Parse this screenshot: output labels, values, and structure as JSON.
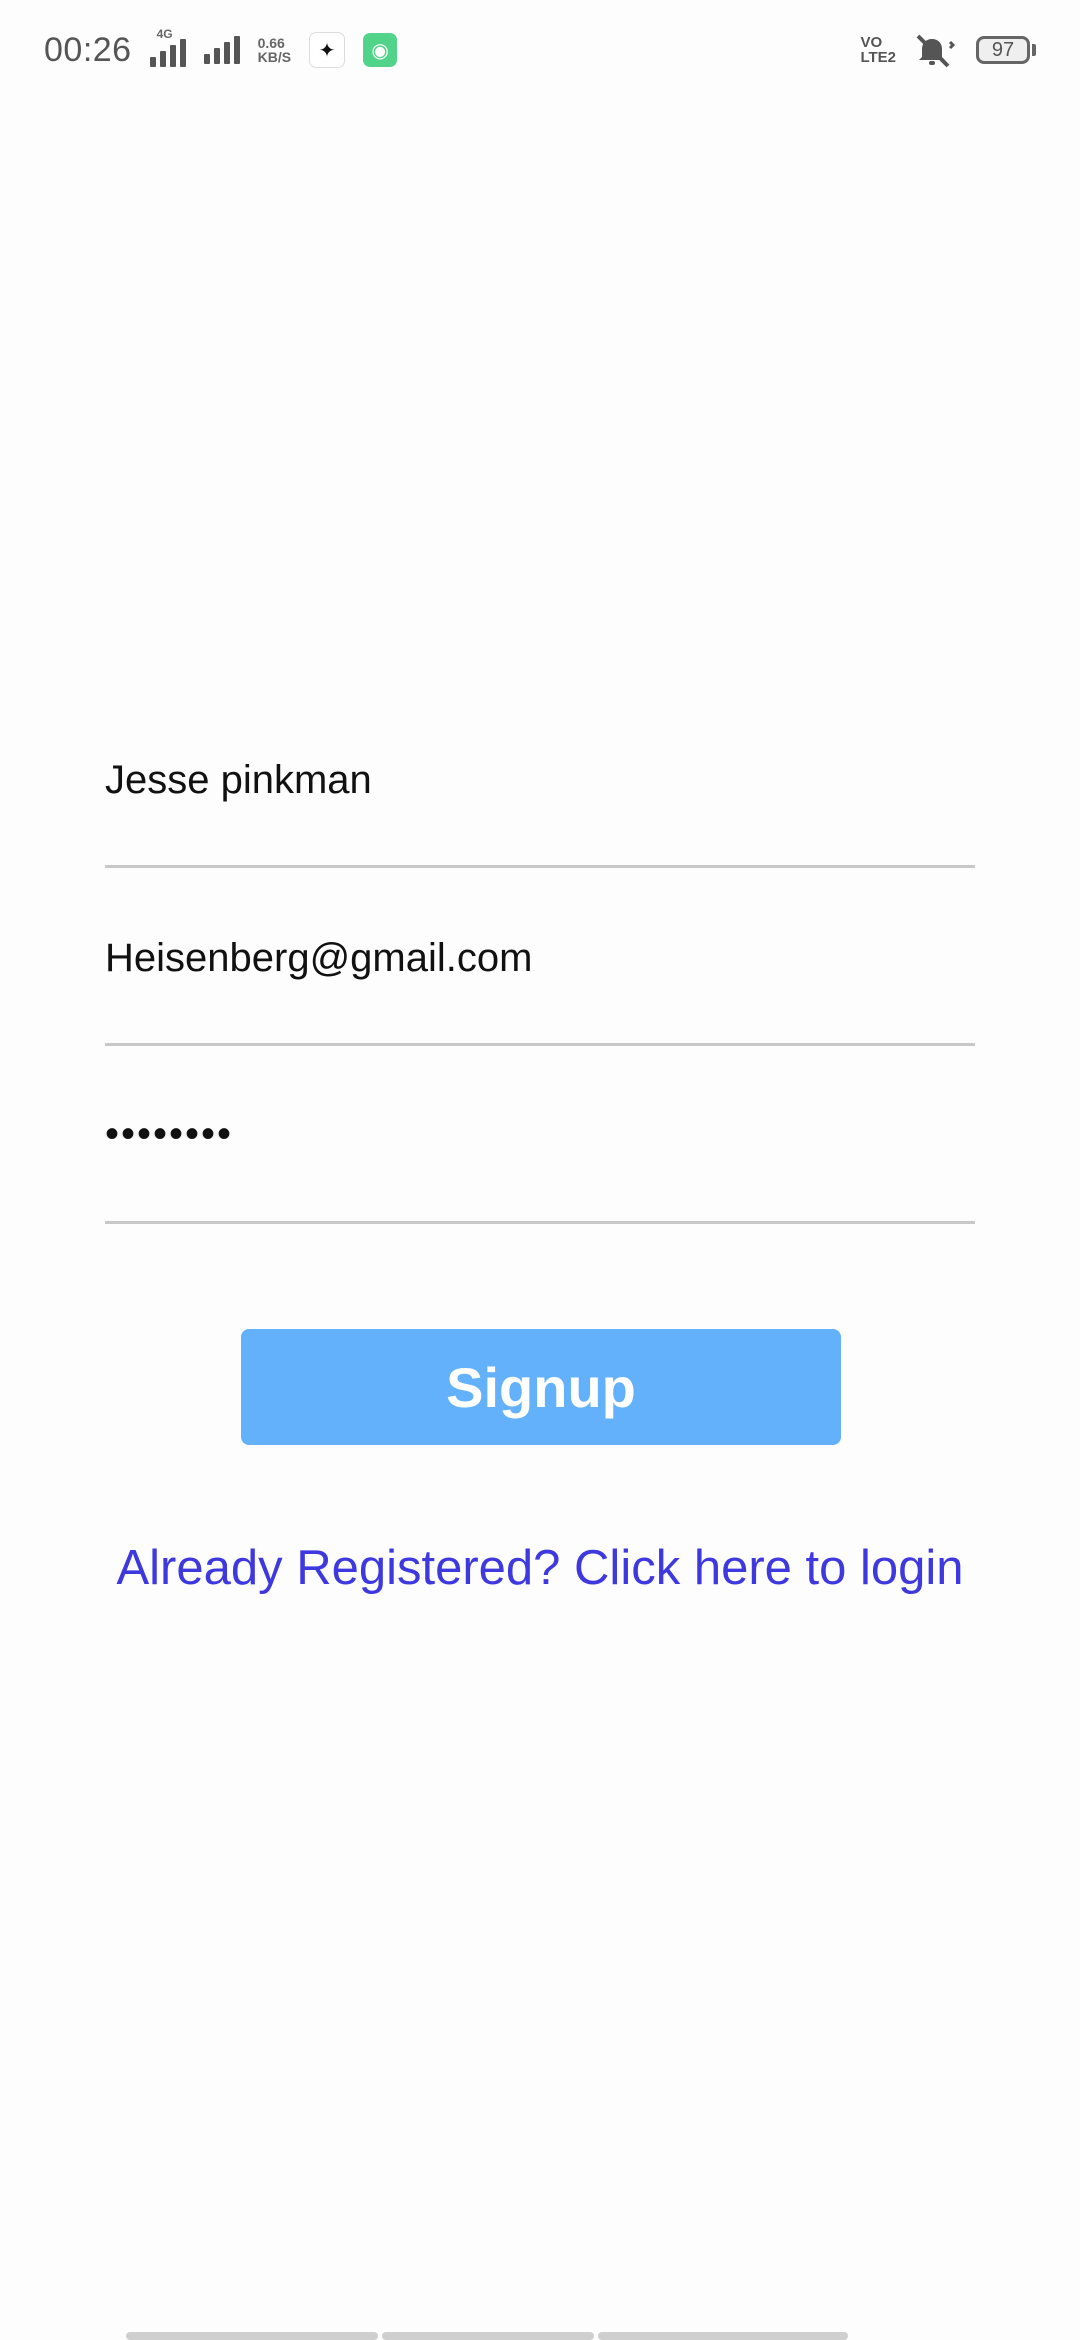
{
  "status_bar": {
    "time": "00:26",
    "network_type": "4G",
    "net_rate_value": "0.66",
    "net_rate_unit": "KB/S",
    "volte_top": "VO",
    "volte_bottom": "LTE2",
    "battery_level": "97",
    "icons": [
      "signal-icon",
      "app-icon-black",
      "app-icon-green",
      "mute-icon",
      "battery-icon"
    ]
  },
  "form": {
    "name_value": "Jesse pinkman",
    "email_value": "Heisenberg@gmail.com",
    "password_masked": "••••••••"
  },
  "actions": {
    "signup_label": "Signup",
    "login_link_text": "Already Registered? Click here to login"
  },
  "colors": {
    "signup_button": "#64b1fb",
    "link": "#3e39df",
    "underline": "#c8c8c8"
  }
}
